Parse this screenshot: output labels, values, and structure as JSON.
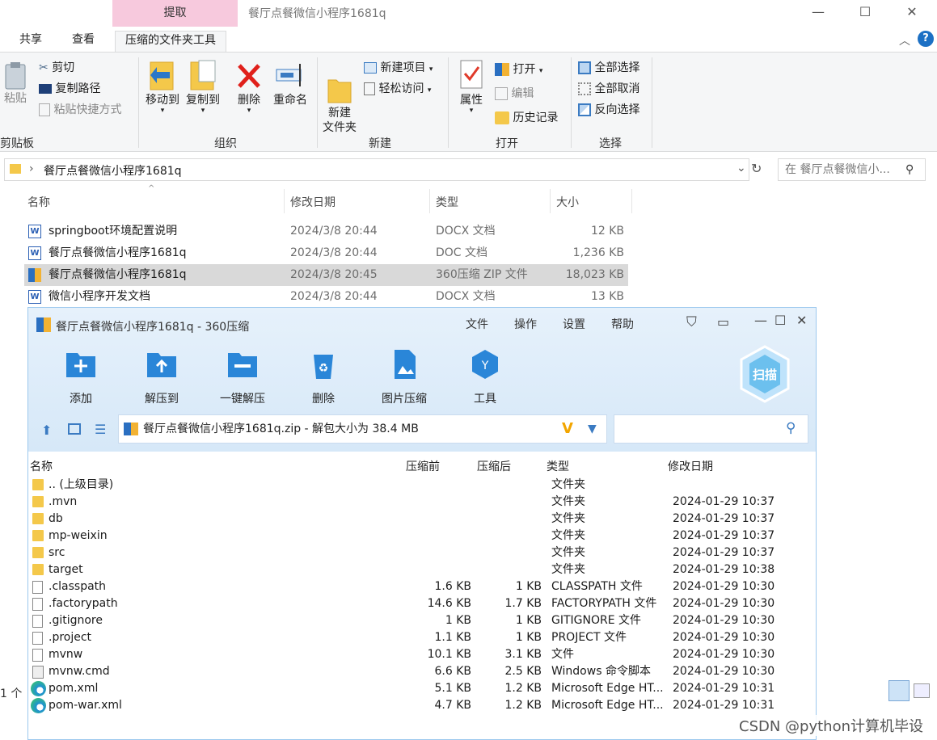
{
  "explorer": {
    "context_tab": "提取",
    "window_title": "餐厅点餐微信小程序1681q",
    "tabs": [
      "共享",
      "查看",
      "压缩的文件夹工具"
    ],
    "ribbon": {
      "clipboard": {
        "paste": "粘贴",
        "cut": "剪切",
        "copy_path": "复制路径",
        "paste_shortcut": "粘贴快捷方式",
        "label": "剪贴板"
      },
      "organize": {
        "move_to": "移动到",
        "copy_to": "复制到",
        "delete": "删除",
        "rename": "重命名",
        "label": "组织"
      },
      "new": {
        "new_folder": "新建\n文件夹",
        "new_item": "新建项目",
        "easy_access": "轻松访问",
        "label": "新建"
      },
      "open": {
        "properties": "属性",
        "open": "打开",
        "edit": "编辑",
        "history": "历史记录",
        "label": "打开"
      },
      "select": {
        "select_all": "全部选择",
        "select_none": "全部取消",
        "invert": "反向选择",
        "label": "选择"
      }
    },
    "address": "餐厅点餐微信小程序1681q",
    "search_placeholder": "在 餐厅点餐微信小...",
    "columns": {
      "name": "名称",
      "date": "修改日期",
      "type": "类型",
      "size": "大小"
    },
    "files": [
      {
        "name": "springboot环境配置说明",
        "date": "2024/3/8 20:44",
        "type": "DOCX 文档",
        "size": "12 KB"
      },
      {
        "name": "餐厅点餐微信小程序1681q",
        "date": "2024/3/8 20:44",
        "type": "DOC 文档",
        "size": "1,236 KB"
      },
      {
        "name": "餐厅点餐微信小程序1681q",
        "date": "2024/3/8 20:45",
        "type": "360压缩 ZIP 文件",
        "size": "18,023 KB"
      },
      {
        "name": "微信小程序开发文档",
        "date": "2024/3/8 20:44",
        "type": "DOCX 文档",
        "size": "13 KB"
      }
    ],
    "status_count": "1 个"
  },
  "zip": {
    "title": "餐厅点餐微信小程序1681q - 360压缩",
    "menu": [
      "文件",
      "操作",
      "设置",
      "帮助"
    ],
    "tools": [
      "添加",
      "解压到",
      "一键解压",
      "删除",
      "图片压缩",
      "工具"
    ],
    "scan": "扫描",
    "path": "餐厅点餐微信小程序1681q.zip - 解包大小为 38.4 MB",
    "columns": {
      "name": "名称",
      "before": "压缩前",
      "after": "压缩后",
      "type": "类型",
      "date": "修改日期"
    },
    "rows": [
      {
        "name": ".. (上级目录)",
        "before": "",
        "after": "",
        "type": "文件夹",
        "date": "",
        "icon": "folder"
      },
      {
        "name": ".mvn",
        "before": "",
        "after": "",
        "type": "文件夹",
        "date": "2024-01-29 10:37",
        "icon": "folder"
      },
      {
        "name": "db",
        "before": "",
        "after": "",
        "type": "文件夹",
        "date": "2024-01-29 10:37",
        "icon": "folder"
      },
      {
        "name": "mp-weixin",
        "before": "",
        "after": "",
        "type": "文件夹",
        "date": "2024-01-29 10:37",
        "icon": "folder"
      },
      {
        "name": "src",
        "before": "",
        "after": "",
        "type": "文件夹",
        "date": "2024-01-29 10:37",
        "icon": "folder"
      },
      {
        "name": "target",
        "before": "",
        "after": "",
        "type": "文件夹",
        "date": "2024-01-29 10:38",
        "icon": "folder"
      },
      {
        "name": ".classpath",
        "before": "1.6 KB",
        "after": "1 KB",
        "type": "CLASSPATH 文件",
        "date": "2024-01-29 10:30",
        "icon": "file"
      },
      {
        "name": ".factorypath",
        "before": "14.6 KB",
        "after": "1.7 KB",
        "type": "FACTORYPATH 文件",
        "date": "2024-01-29 10:30",
        "icon": "file"
      },
      {
        "name": ".gitignore",
        "before": "1 KB",
        "after": "1 KB",
        "type": "GITIGNORE 文件",
        "date": "2024-01-29 10:30",
        "icon": "file"
      },
      {
        "name": ".project",
        "before": "1.1 KB",
        "after": "1 KB",
        "type": "PROJECT 文件",
        "date": "2024-01-29 10:30",
        "icon": "file"
      },
      {
        "name": "mvnw",
        "before": "10.1 KB",
        "after": "3.1 KB",
        "type": "文件",
        "date": "2024-01-29 10:30",
        "icon": "file"
      },
      {
        "name": "mvnw.cmd",
        "before": "6.6 KB",
        "after": "2.5 KB",
        "type": "Windows 命令脚本",
        "date": "2024-01-29 10:30",
        "icon": "cmd"
      },
      {
        "name": "pom.xml",
        "before": "5.1 KB",
        "after": "1.2 KB",
        "type": "Microsoft Edge HT...",
        "date": "2024-01-29 10:31",
        "icon": "edge"
      },
      {
        "name": "pom-war.xml",
        "before": "4.7 KB",
        "after": "1.2 KB",
        "type": "Microsoft Edge HT...",
        "date": "2024-01-29 10:31",
        "icon": "edge"
      }
    ]
  },
  "watermark": "CSDN @python计算机毕设"
}
